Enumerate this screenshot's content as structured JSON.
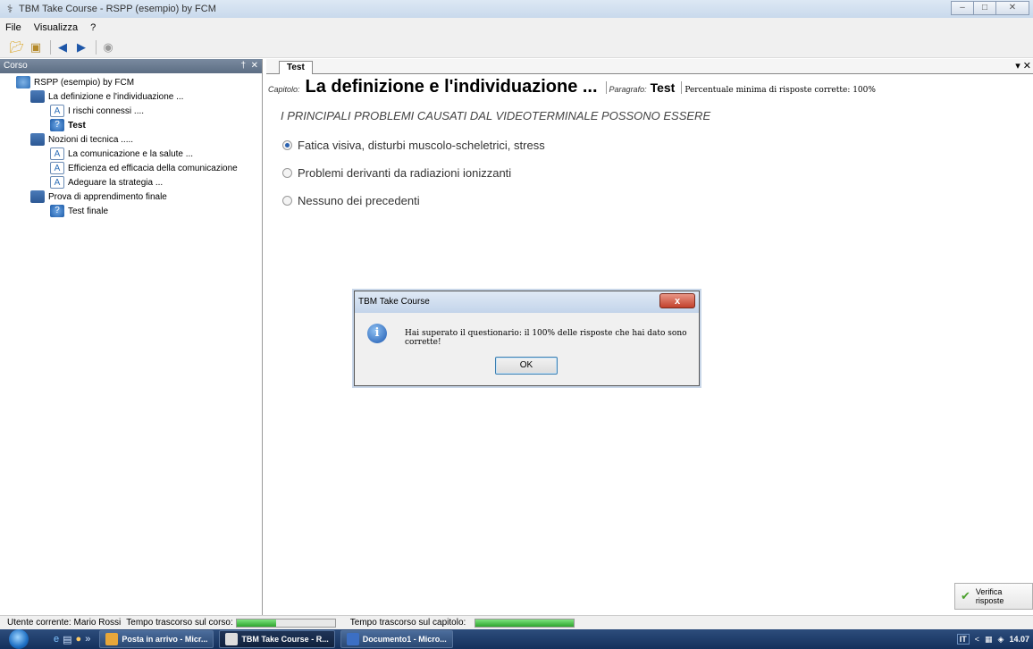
{
  "window": {
    "title": "TBM Take Course - RSPP (esempio) by FCM",
    "controls": [
      "–",
      "□",
      "✕"
    ]
  },
  "menu": {
    "items": [
      "File",
      "Visualizza",
      "?"
    ]
  },
  "left_panel": {
    "title": "Corso",
    "pin": "†",
    "close": "✕",
    "tree": [
      {
        "label": "RSPP (esempio) by FCM",
        "icon": "course-globe-icon",
        "level": 0
      },
      {
        "label": "La definizione e l'individuazione ...",
        "icon": "chapter-book-icon",
        "level": 1
      },
      {
        "label": "I rischi connessi ....",
        "icon": "page-icon",
        "level": 2
      },
      {
        "label": "Test",
        "icon": "test-icon",
        "level": 2,
        "bold": true
      },
      {
        "label": "Nozioni di tecnica .....",
        "icon": "chapter-book-icon",
        "level": 1
      },
      {
        "label": "La comunicazione e la salute ...",
        "icon": "page-icon",
        "level": 2
      },
      {
        "label": "Efficienza ed efficacia della comunicazione",
        "icon": "page-icon",
        "level": 2
      },
      {
        "label": "Adeguare la strategia ...",
        "icon": "page-icon",
        "level": 2
      },
      {
        "label": "Prova di apprendimento finale",
        "icon": "chapter-book-icon",
        "level": 1
      },
      {
        "label": "Test finale",
        "icon": "test-icon",
        "level": 2
      }
    ]
  },
  "content": {
    "tab": "Test",
    "tab_controls": "▾ ✕",
    "chapter_label": "Capitolo:",
    "chapter_title": "La definizione e l'individuazione ...",
    "paragraph_label": "Paragrafo:",
    "paragraph_title": "Test",
    "min_pct": "Percentuale minima di risposte corrette:  100%",
    "question": "I PRINCIPALI PROBLEMI CAUSATI DAL VIDEOTERMINALE POSSONO ESSERE",
    "answers": [
      {
        "label": "Fatica visiva, disturbi muscolo-scheletrici, stress",
        "checked": true
      },
      {
        "label": "Problemi derivanti da radiazioni ionizzanti",
        "checked": false
      },
      {
        "label": "Nessuno dei precedenti",
        "checked": false
      }
    ],
    "verify_button": "Verifica risposte"
  },
  "dialog": {
    "title": "TBM Take Course",
    "close": "x",
    "message": "Hai superato il questionario: il 100% delle risposte che hai dato sono corrette!",
    "ok": "OK"
  },
  "status": {
    "user_label": "Utente corrente: Mario Rossi",
    "course_time_label": "Tempo trascorso sul corso:",
    "course_progress": 0.4,
    "chapter_time_label": "Tempo trascorso sul capitolo:",
    "chapter_progress": 1.0
  },
  "taskbar": {
    "quicklaunch": [
      "»"
    ],
    "tasks": [
      {
        "label": "Posta in arrivo - Micr...",
        "active": false
      },
      {
        "label": "TBM Take Course - R...",
        "active": true
      },
      {
        "label": "Documento1 - Micro...",
        "active": false
      }
    ],
    "tray": {
      "lang": "IT",
      "arrow": "<",
      "time": "14.07"
    }
  },
  "colors": {
    "accent": "#2b62b0",
    "progress": "#2ea52e",
    "taskbar": "#1c3b69"
  }
}
